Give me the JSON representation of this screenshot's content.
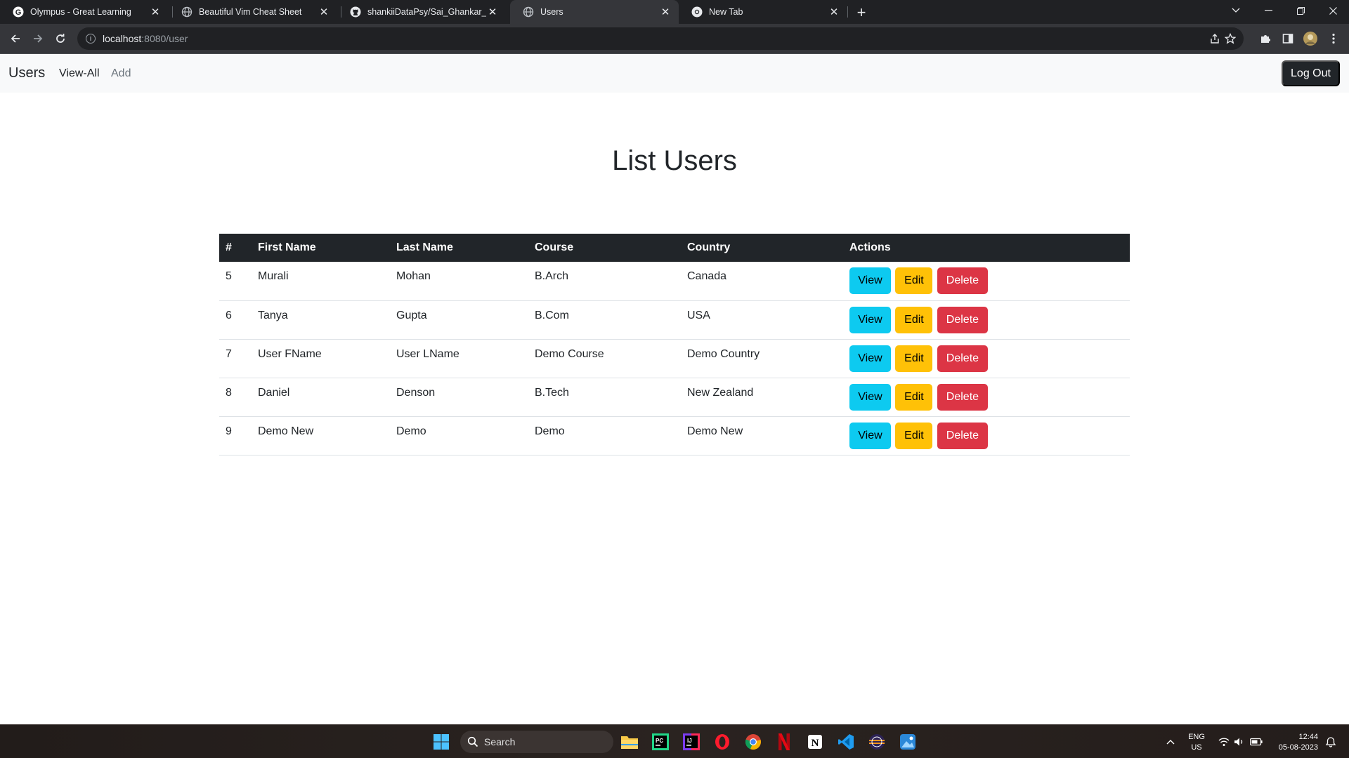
{
  "browser": {
    "tabs": [
      {
        "title": "Olympus - Great Learning",
        "icon": "google-g-icon"
      },
      {
        "title": "Beautiful Vim Cheat Sheet",
        "icon": "globe-icon"
      },
      {
        "title": "shankiiDataPsy/Sai_Ghankar_G_B",
        "icon": "github-icon"
      },
      {
        "title": "Users",
        "icon": "globe-icon",
        "active": true
      },
      {
        "title": "New Tab",
        "icon": "chrome-icon"
      }
    ],
    "url_host": "localhost",
    "url_rest": ":8080/user"
  },
  "navbar": {
    "brand": "Users",
    "links": [
      {
        "label": "View-All",
        "active": true
      },
      {
        "label": "Add",
        "active": false
      }
    ],
    "logout_label": "Log Out"
  },
  "page": {
    "title": "List Users"
  },
  "table": {
    "headers": [
      "#",
      "First Name",
      "Last Name",
      "Course",
      "Country",
      "Actions"
    ],
    "rows": [
      {
        "id": "5",
        "first_name": "Murali",
        "last_name": "Mohan",
        "course": "B.Arch",
        "country": "Canada"
      },
      {
        "id": "6",
        "first_name": "Tanya",
        "last_name": "Gupta",
        "course": "B.Com",
        "country": "USA"
      },
      {
        "id": "7",
        "first_name": "User FName",
        "last_name": "User LName",
        "course": "Demo Course",
        "country": "Demo Country"
      },
      {
        "id": "8",
        "first_name": "Daniel",
        "last_name": "Denson",
        "course": "B.Tech",
        "country": "New Zealand"
      },
      {
        "id": "9",
        "first_name": "Demo New",
        "last_name": "Demo",
        "course": "Demo",
        "country": "Demo New"
      }
    ],
    "actions": {
      "view": "View",
      "edit": "Edit",
      "delete": "Delete"
    }
  },
  "colors": {
    "view": "#0dcaf0",
    "edit": "#ffc107",
    "delete": "#dc3545",
    "dark": "#212529"
  },
  "taskbar": {
    "search_label": "Search",
    "apps": [
      "windows-start-icon",
      "file-explorer-icon",
      "pycharm-icon",
      "intellij-icon",
      "opera-icon",
      "chrome-icon",
      "netflix-icon",
      "notion-icon",
      "vscode-icon",
      "eclipse-icon",
      "photos-icon"
    ],
    "lang_line1": "ENG",
    "lang_line2": "US",
    "time": "12:44",
    "date": "05-08-2023"
  }
}
